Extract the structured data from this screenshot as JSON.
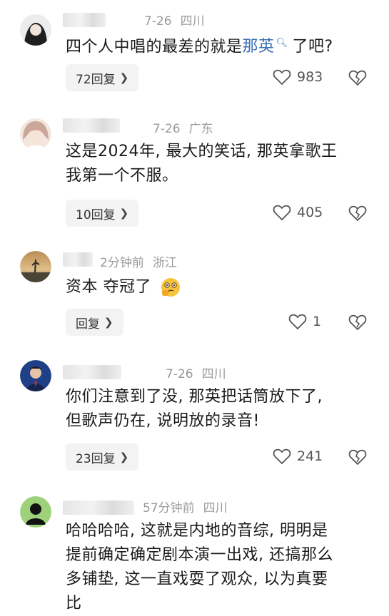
{
  "comments": [
    {
      "date": "7-26",
      "location": "四川",
      "text_before": "四个人中唱的最差的就是",
      "link": "那英",
      "link_icon": "search-icon",
      "text_after": "了吧?",
      "reply_label": "72回复",
      "likes": "983",
      "avatar_colors": [
        "#222222",
        "#f0f0f0"
      ]
    },
    {
      "date": "7-26",
      "location": "广东",
      "text_lines": [
        "这是2024年, 最大的笑话, 那英拿歌王",
        "我第一个不服。"
      ],
      "reply_label": "10回复",
      "likes": "405",
      "avatar_colors": [
        "#d9c2b6",
        "#f6e7e0"
      ]
    },
    {
      "time": "2分钟前",
      "location": "浙江",
      "text": "资本 夺冠了",
      "emoji": "thinking-face-emoji",
      "reply_label": "回复",
      "likes": "1",
      "avatar_colors": [
        "#c9a56a",
        "#4a4a4a"
      ]
    },
    {
      "date": "7-26",
      "location": "四川",
      "text_lines": [
        "你们注意到了没, 那英把话筒放下了,",
        "但歌声仍在, 说明放的录音!"
      ],
      "reply_label": "23回复",
      "likes": "241",
      "avatar_colors": [
        "#2a4f9a",
        "#e8c7b0"
      ]
    },
    {
      "time": "57分钟前",
      "location": "四川",
      "text_lines": [
        "哈哈哈哈, 这就是内地的音综, 明明是",
        "提前确定确定剧本演一出戏, 还搞那么",
        "多铺垫, 这一直戏耍了观众, 以为真要",
        "比"
      ],
      "avatar_colors": [
        "#9ed27a",
        "#111111"
      ]
    }
  ],
  "icons": {
    "like": "heart-icon",
    "dislike": "broken-heart-icon",
    "chevron": "chevron-right-icon"
  }
}
